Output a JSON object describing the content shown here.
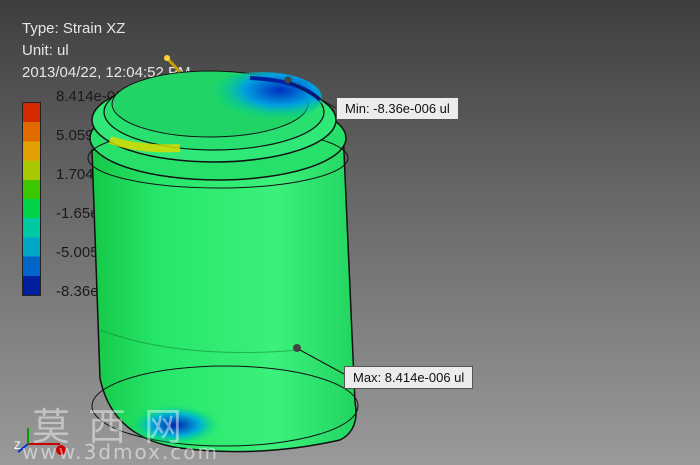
{
  "header": {
    "type_line": "Type: Strain XZ",
    "unit_line": "Unit: ul",
    "timestamp": "2013/04/22, 12:04:52 PM"
  },
  "legend": {
    "colors": [
      "#d42a00",
      "#e06a00",
      "#e0a000",
      "#a8c800",
      "#3cc800",
      "#00d24a",
      "#00c8a0",
      "#00a8c8",
      "#0064c8",
      "#0020a0"
    ],
    "labels": [
      "8.414e-006 Max",
      "5.059e-006",
      "1.704e-006",
      "-1.65e-006",
      "-5.005e-006",
      "-8.36e-006 Min"
    ]
  },
  "probes": {
    "min_label": "Min: -8.36e-006 ul",
    "max_label": "Max: 8.414e-006 ul"
  },
  "triad": {
    "z_label": "Z"
  },
  "watermark": {
    "chinese": "莫西网",
    "url": "www.3dmox.com"
  }
}
